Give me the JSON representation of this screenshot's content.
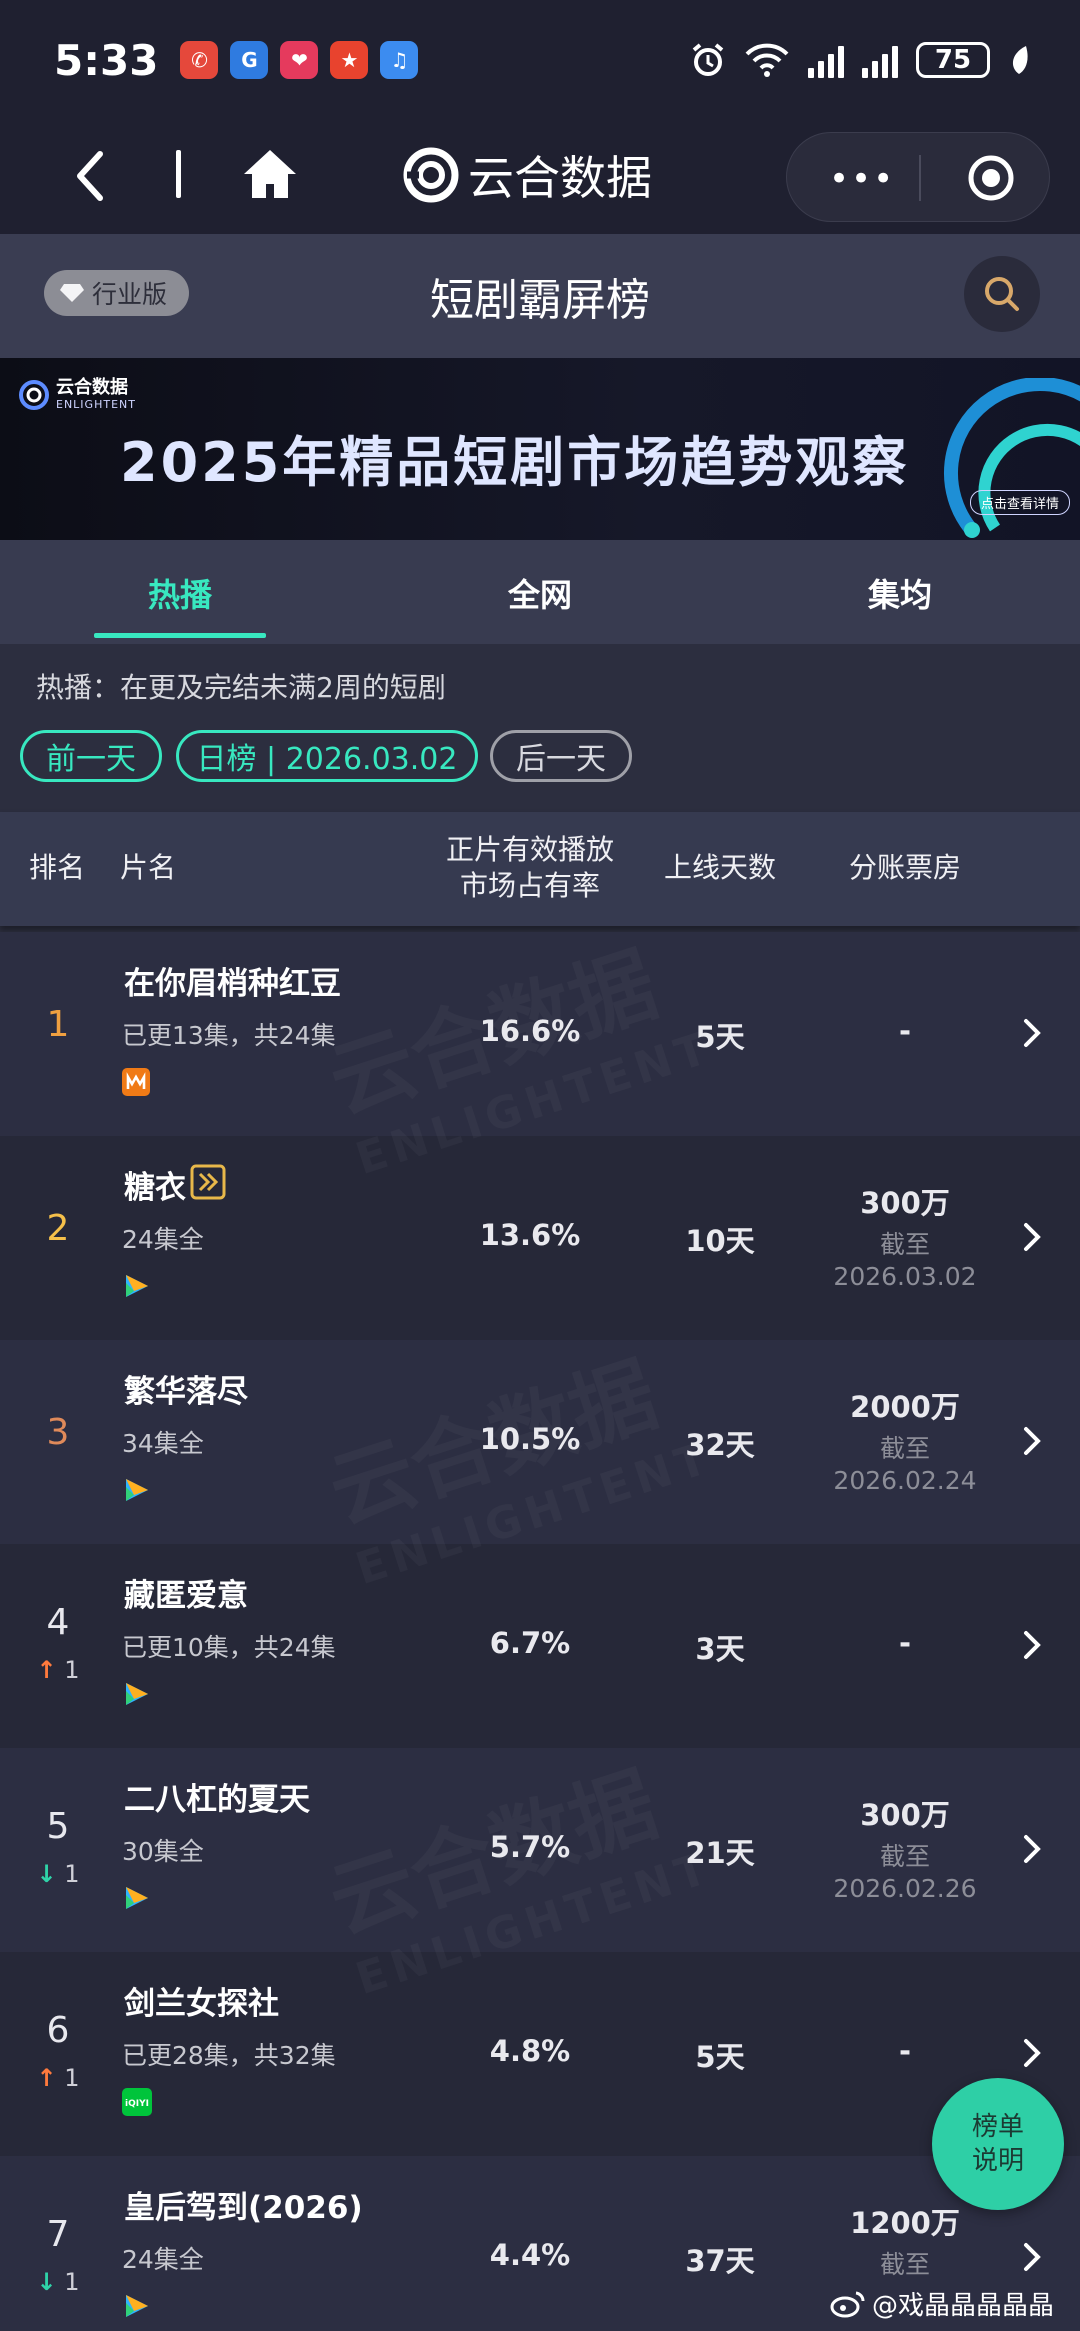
{
  "status_bar": {
    "time": "5:33",
    "battery": "75",
    "app_icons": [
      {
        "name": "missed-call-icon",
        "color": "#e5483b",
        "glyph": "✆"
      },
      {
        "name": "bank-app-icon",
        "color": "#2f7be0",
        "glyph": "G"
      },
      {
        "name": "shopping-app-icon",
        "color": "#e53a5d",
        "glyph": "❤"
      },
      {
        "name": "promo-app-icon",
        "color": "#e8432e",
        "glyph": "★"
      },
      {
        "name": "music-app-icon",
        "color": "#3c8cf0",
        "glyph": "♫"
      }
    ]
  },
  "navbar": {
    "brand_name": "云合数据"
  },
  "titlebar": {
    "badge": "行业版",
    "title": "短剧霸屏榜"
  },
  "banner": {
    "logo_cn": "云合数据",
    "logo_en": "ENLIGHTENT",
    "title": "2025年精品短剧市场趋势观察",
    "cta": "点击查看详情"
  },
  "tabs": [
    {
      "label": "热播",
      "active": true
    },
    {
      "label": "全网",
      "active": false
    },
    {
      "label": "集均",
      "active": false
    }
  ],
  "description": "热播：在更及完结未满2周的短剧",
  "date_nav": {
    "prev": "前一天",
    "current": "日榜 | 2026.03.02",
    "next": "后一天"
  },
  "table": {
    "headers": {
      "rank": "排名",
      "name": "片名",
      "share_line1": "正片有效播放",
      "share_line2": "市场占有率",
      "days": "上线天数",
      "box": "分账票房"
    },
    "rows": [
      {
        "rank": "1",
        "rank_color": "#f0a040",
        "trend_dir": "",
        "trend_val": "",
        "name": "在你眉梢种红豆",
        "sub": "已更13集，共24集",
        "platform": "mango",
        "share": "16.6%",
        "days": "5天",
        "box": "-",
        "asof_label": "",
        "asof_date": "",
        "tag": false
      },
      {
        "rank": "2",
        "rank_color": "#f5c04a",
        "trend_dir": "",
        "trend_val": "",
        "name": "糖衣",
        "sub": "24集全",
        "platform": "tencent",
        "share": "13.6%",
        "days": "10天",
        "box": "300万",
        "asof_label": "截至",
        "asof_date": "2026.03.02",
        "tag": true
      },
      {
        "rank": "3",
        "rank_color": "#e08a5a",
        "trend_dir": "",
        "trend_val": "",
        "name": "繁华落尽",
        "sub": "34集全",
        "platform": "tencent",
        "share": "10.5%",
        "days": "32天",
        "box": "2000万",
        "asof_label": "截至",
        "asof_date": "2026.02.24",
        "tag": false
      },
      {
        "rank": "4",
        "rank_color": "#e8e8ee",
        "trend_dir": "up",
        "trend_val": "1",
        "name": "藏匿爱意",
        "sub": "已更10集，共24集",
        "platform": "tencent",
        "share": "6.7%",
        "days": "3天",
        "box": "-",
        "asof_label": "",
        "asof_date": "",
        "tag": false
      },
      {
        "rank": "5",
        "rank_color": "#e8e8ee",
        "trend_dir": "down",
        "trend_val": "1",
        "name": "二八杠的夏天",
        "sub": "30集全",
        "platform": "tencent",
        "share": "5.7%",
        "days": "21天",
        "box": "300万",
        "asof_label": "截至",
        "asof_date": "2026.02.26",
        "tag": false
      },
      {
        "rank": "6",
        "rank_color": "#e8e8ee",
        "trend_dir": "up",
        "trend_val": "1",
        "name": "剑兰女探社",
        "sub": "已更28集，共32集",
        "platform": "iqiyi",
        "share": "4.8%",
        "days": "5天",
        "box": "-",
        "asof_label": "",
        "asof_date": "",
        "tag": false
      },
      {
        "rank": "7",
        "rank_color": "#e8e8ee",
        "trend_dir": "down",
        "trend_val": "1",
        "name": "皇后驾到(2026)",
        "sub": "24集全",
        "platform": "tencent",
        "share": "4.4%",
        "days": "37天",
        "box": "1200万",
        "asof_label": "截至",
        "asof_date": "",
        "tag": false
      }
    ]
  },
  "fab": {
    "line1": "榜单",
    "line2": "说明"
  },
  "watermark": {
    "cn": "云合数据",
    "en": "ENLIGHTENT"
  },
  "weibo_credit": "@戏晶晶晶晶晶",
  "colors": {
    "accent": "#38e8c0",
    "up": "#ff7a3d",
    "down": "#2fd3a8"
  }
}
